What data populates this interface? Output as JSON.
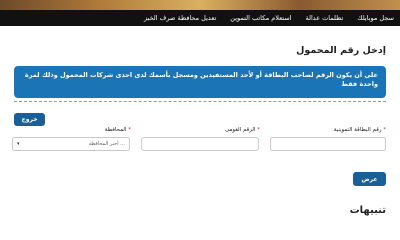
{
  "nav": {
    "items": [
      {
        "label": "سجل موبايلك"
      },
      {
        "label": "تظلمات عدالة"
      },
      {
        "label": "استعلام مكاتب التموين"
      },
      {
        "label": "تعديل محافظة صرف الخبز"
      }
    ]
  },
  "page": {
    "title": "إدخل رقم المحمول",
    "notice": "على أن يكون الرقم لصاحب البطاقة أو لأحد المستفيدين ومسجل بأسمك لدى احدى شركات المحمول وذلك لمرة واحدة فقط"
  },
  "buttons": {
    "logout": "خروج",
    "submit": "عرض"
  },
  "form": {
    "card_label": "رقم البطاقة التموينية",
    "card_value": "",
    "national_id_label": "الرقم القومى",
    "national_id_value": "",
    "governorate_label": "المحافظة",
    "governorate_selected": "... أختر المحافظة",
    "required_mark": "*"
  },
  "sections": {
    "alerts_title": "تنبيهات"
  },
  "colors": {
    "nav_bg": "#111111",
    "accent": "#1a74b5",
    "button": "#1a5f96",
    "required": "#d9241c"
  }
}
